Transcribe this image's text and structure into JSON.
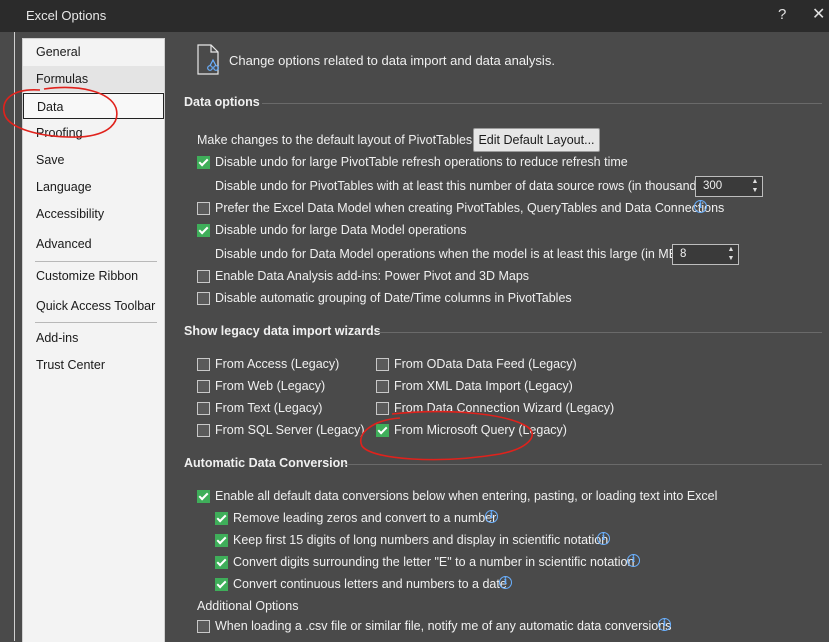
{
  "window": {
    "title": "Excel Options",
    "help": "?",
    "close": "✕"
  },
  "sidebar": {
    "items": [
      {
        "label": "General"
      },
      {
        "label": "Formulas"
      },
      {
        "label": "Data"
      },
      {
        "label": "Proofing"
      },
      {
        "label": "Save"
      },
      {
        "label": "Language"
      },
      {
        "label": "Accessibility"
      },
      {
        "label": "Advanced"
      },
      {
        "label": "Customize Ribbon"
      },
      {
        "label": "Quick Access Toolbar"
      },
      {
        "label": "Add-ins"
      },
      {
        "label": "Trust Center"
      }
    ],
    "selected": "Data"
  },
  "header": {
    "text": "Change options related to data import and data analysis."
  },
  "data_options": {
    "title": "Data options",
    "default_layout_label": "Make changes to the default layout of PivotTables:",
    "edit_default_layout_button": "Edit Default Layout...",
    "disable_undo_pivot": {
      "label": "Disable undo for large PivotTable refresh operations to reduce refresh time",
      "checked": true
    },
    "undo_pivot_rows_label": "Disable undo for PivotTables with at least this number of data source rows (in thousands):",
    "undo_pivot_rows_value": "300",
    "prefer_data_model": {
      "label": "Prefer the Excel Data Model when creating PivotTables, QueryTables and Data Connections",
      "checked": false
    },
    "disable_undo_model": {
      "label": "Disable undo for large Data Model operations",
      "checked": true
    },
    "undo_model_size_label": "Disable undo for Data Model operations when the model is at least this large (in MB):",
    "undo_model_size_value": "8",
    "enable_addins": {
      "label": "Enable Data Analysis add-ins: Power Pivot and 3D Maps",
      "checked": false
    },
    "disable_grouping": {
      "label": "Disable automatic grouping of Date/Time columns in PivotTables",
      "checked": false
    }
  },
  "legacy": {
    "title": "Show legacy data import wizards",
    "items": [
      {
        "label": "From Access (Legacy)",
        "checked": false
      },
      {
        "label": "From Web (Legacy)",
        "checked": false
      },
      {
        "label": "From Text (Legacy)",
        "checked": false
      },
      {
        "label": "From SQL Server (Legacy)",
        "checked": false
      },
      {
        "label": "From OData Data Feed (Legacy)",
        "checked": false
      },
      {
        "label": "From XML Data Import (Legacy)",
        "checked": false
      },
      {
        "label": "From Data Connection Wizard (Legacy)",
        "checked": false
      },
      {
        "label": "From Microsoft Query (Legacy)",
        "checked": true
      }
    ]
  },
  "conversion": {
    "title": "Automatic Data Conversion",
    "enable_all": {
      "label": "Enable all default data conversions below when entering, pasting, or loading text into Excel",
      "checked": true
    },
    "items": [
      {
        "label": "Remove leading zeros and convert to a number",
        "checked": true
      },
      {
        "label": "Keep first 15 digits of long numbers and display in scientific notation",
        "checked": true
      },
      {
        "label": "Convert digits surrounding the letter \"E\" to a number in scientific notation",
        "checked": true
      },
      {
        "label": "Convert continuous letters and numbers to a date",
        "checked": true
      }
    ],
    "additional_title": "Additional Options",
    "csv_notify": {
      "label": "When loading a .csv file or similar file, notify me of any automatic data conversions",
      "checked": false
    }
  },
  "colors": {
    "accent_check": "#3fae5a",
    "annotation": "#e0221c",
    "info": "#6ab0ff"
  }
}
